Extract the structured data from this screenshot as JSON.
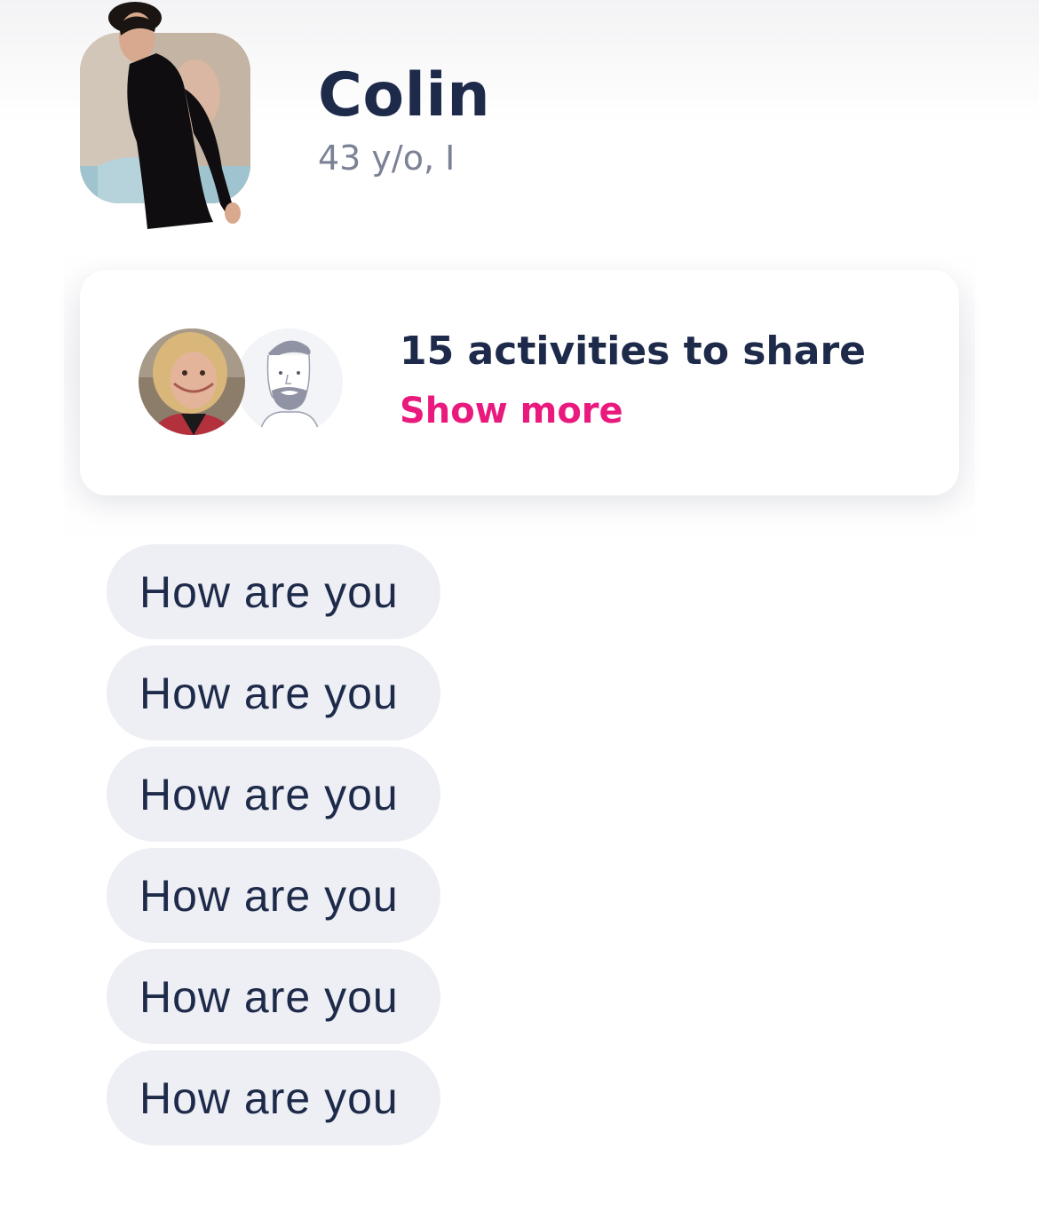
{
  "profile": {
    "name": "Colin",
    "meta": "43 y/o, I",
    "avatar_icon": "profile-photo-icon"
  },
  "activities": {
    "title": "15 activities to share",
    "show_more_label": "Show more",
    "avatars": [
      "woman-avatar-icon",
      "bearded-man-avatar-icon"
    ]
  },
  "suggestions": [
    {
      "label": "How are you"
    },
    {
      "label": "How are you"
    },
    {
      "label": "How are you"
    },
    {
      "label": "How are you"
    },
    {
      "label": "How are you"
    },
    {
      "label": "How are you"
    }
  ],
  "colors": {
    "text_primary": "#1d2a4a",
    "text_secondary": "#7b8296",
    "accent": "#e9197d",
    "chip_background": "#eeeff4"
  }
}
